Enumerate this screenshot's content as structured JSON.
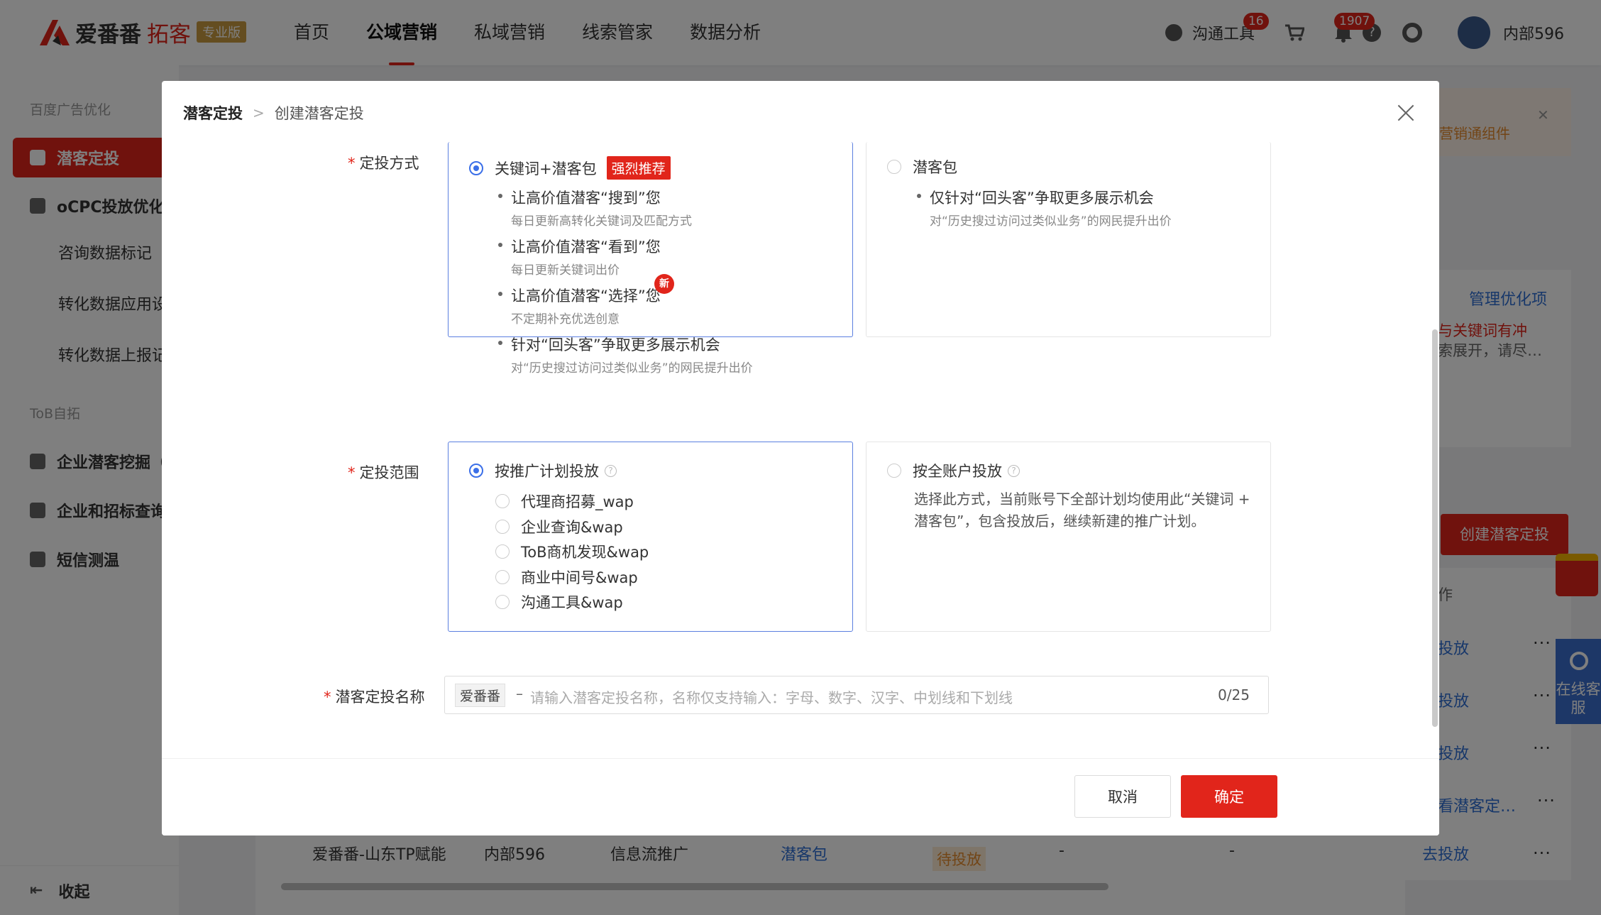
{
  "brand": {
    "name": "爱番番",
    "product": "拓客",
    "edition": "专业版",
    "accent": "#e1251b"
  },
  "nav": {
    "items": [
      {
        "label": "首页"
      },
      {
        "label": "公域营销"
      },
      {
        "label": "私域营销"
      },
      {
        "label": "线索管家"
      },
      {
        "label": "数据分析"
      }
    ],
    "active_index": 1
  },
  "toolbar": {
    "comm_tool": "沟通工具",
    "comm_badge": "16",
    "bell_badge": "1907",
    "user": "内部596"
  },
  "sidebar": {
    "group1": "百度广告优化",
    "items": [
      {
        "label": "潜客定投",
        "icon": "target-icon"
      },
      {
        "label": "oCPC投放优化",
        "icon": "clipboard-icon"
      }
    ],
    "subs": [
      "咨询数据标记",
      "转化数据应用设",
      "转化数据上报记"
    ],
    "group2": "ToB自拓",
    "items2": [
      {
        "label": "企业潜客挖掘（",
        "icon": "chart-icon"
      },
      {
        "label": "企业和招标查询",
        "icon": "search-doc-icon"
      },
      {
        "label": "短信测温",
        "icon": "mail-icon"
      }
    ],
    "collapse": "收起"
  },
  "background": {
    "notice": "营销通组件",
    "manage_link": "管理优化项",
    "conflict_red": "与关键词有冲",
    "conflict_gray": "索展开，请尽…",
    "create_button": "创建潜客定投",
    "col_header": "作",
    "row_actions": [
      "投放",
      "投放",
      "投放",
      "看潜客定…"
    ],
    "last_row": {
      "name": "爱番番-山东TP赋能",
      "account": "内部596",
      "type": "信息流推广",
      "mode": "潜客包",
      "status": "待投放",
      "c1": "-",
      "c2": "-",
      "action": "去投放"
    },
    "cs_label": "在线客服",
    "more": "···"
  },
  "modal": {
    "breadcrumb_root": "潜客定投",
    "breadcrumb_current": "创建潜客定投",
    "mode_label": "定投方式",
    "mode_options": [
      {
        "title": "关键词+潜客包",
        "tag": "强烈推荐",
        "selected": true,
        "bullets": [
          {
            "text": "让高价值潜客“搜到”您",
            "sub": "每日更新高转化关键词及匹配方式"
          },
          {
            "text": "让高价值潜客“看到”您",
            "sub": "每日更新关键词出价"
          },
          {
            "text": "让高价值潜客“选择”您",
            "sub": "不定期补充优选创意",
            "new": "新"
          },
          {
            "text": "针对“回头客”争取更多展示机会",
            "sub": "对“历史搜过访问过类似业务”的网民提升出价"
          }
        ]
      },
      {
        "title": "潜客包",
        "selected": false,
        "bullets": [
          {
            "text": "仅针对“回头客”争取更多展示机会",
            "sub": "对“历史搜过访问过类似业务”的网民提升出价"
          }
        ]
      }
    ],
    "range_label": "定投范围",
    "range_options": [
      {
        "title": "按推广计划投放",
        "selected": true,
        "plans": [
          "代理商招募_wap",
          "企业查询&wap",
          "ToB商机发现&wap",
          "商业中间号&wap",
          "沟通工具&wap"
        ]
      },
      {
        "title": "按全账户投放",
        "selected": false,
        "description": "选择此方式，当前账号下全部计划均使用此“关键词 + 潜客包”，包含投放后，继续新建的推广计划。"
      }
    ],
    "name_label": "潜客定投名称",
    "name_prefix": "爱番番",
    "name_dash": "–",
    "name_placeholder": "请输入潜客定投名称，名称仅支持输入：字母、数字、汉字、中划线和下划线",
    "name_counter": "0/25",
    "cancel": "取消",
    "confirm": "确定"
  }
}
